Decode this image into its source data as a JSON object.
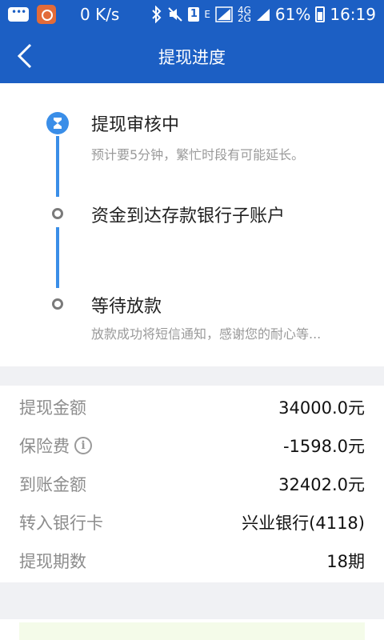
{
  "status_bar": {
    "network_speed": "0 K/s",
    "sim_label": "1",
    "net_e": "E",
    "net_4g_top": "4G",
    "net_4g_bottom": "2G",
    "battery": "61%",
    "time": "16:19"
  },
  "header": {
    "title": "提现进度",
    "back_icon": "chevron-left-icon"
  },
  "progress": {
    "steps": [
      {
        "title": "提现审核中",
        "desc": "预计要5分钟，繁忙时段有可能延长。",
        "state": "active",
        "icon": "hourglass-icon"
      },
      {
        "title": "资金到达存款银行子账户",
        "desc": "",
        "state": "pending"
      },
      {
        "title": "等待放款",
        "desc": "放款成功将短信通知，感谢您的耐心等...",
        "state": "pending"
      }
    ],
    "accent_color": "#3a8ee8"
  },
  "details": {
    "rows": [
      {
        "label": "提现金额",
        "value": "34000.0元"
      },
      {
        "label": "保险费",
        "value": "-1598.0元",
        "info_icon": "i"
      },
      {
        "label": "到账金额",
        "value": "32402.0元"
      },
      {
        "label": "转入银行卡",
        "value": "兴业银行(4118)"
      },
      {
        "label": "提现期数",
        "value": "18期"
      }
    ]
  },
  "colors": {
    "header_bg": "#1c5fc4",
    "page_bg": "#f0f1f4"
  }
}
